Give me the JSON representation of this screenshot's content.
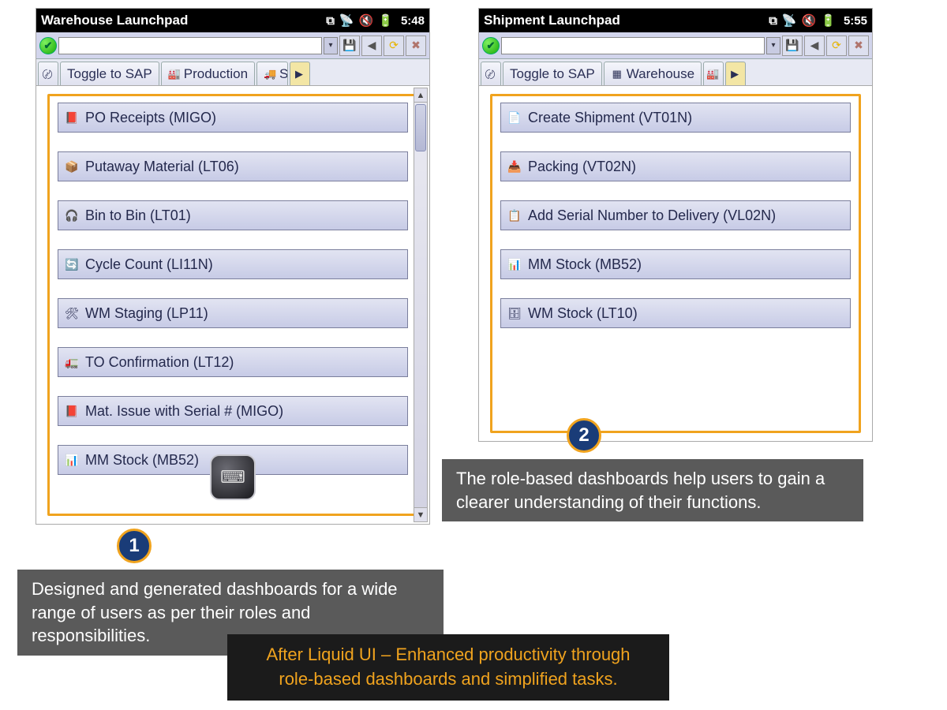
{
  "leftDevice": {
    "statusbar": {
      "title": "Warehouse Launchpad",
      "time": "5:48"
    },
    "tabs": {
      "t0_icon": "〄",
      "t1_label": "Toggle to SAP",
      "t2_icon": "🏭",
      "t2_label": "Production",
      "t3_icon": "🚚",
      "t3_label": "S"
    },
    "rows": [
      {
        "icon": "📕",
        "label": "PO Receipts (MIGO)"
      },
      {
        "icon": "📦",
        "label": "Putaway Material (LT06)"
      },
      {
        "icon": "🎧",
        "label": "Bin to Bin (LT01)"
      },
      {
        "icon": "🔄",
        "label": "Cycle Count (LI11N)"
      },
      {
        "icon": "🛠",
        "label": "WM Staging (LP11)"
      },
      {
        "icon": "🚛",
        "label": "TO Confirmation (LT12)"
      },
      {
        "icon": "📕",
        "label": "Mat. Issue with Serial # (MIGO)"
      },
      {
        "icon": "📊",
        "label": "MM Stock (MB52)"
      }
    ]
  },
  "rightDevice": {
    "statusbar": {
      "title": "Shipment Launchpad",
      "time": "5:55"
    },
    "tabs": {
      "t0_icon": "〄",
      "t1_label": "Toggle to SAP",
      "t2_icon": "▦",
      "t2_label": "Warehouse",
      "t3_icon": "🏭"
    },
    "rows": [
      {
        "icon": "📄",
        "label": "Create Shipment (VT01N)"
      },
      {
        "icon": "📥",
        "label": "Packing (VT02N)"
      },
      {
        "icon": "📋",
        "label": "Add Serial Number to Delivery (VL02N)"
      },
      {
        "icon": "📊",
        "label": "MM Stock (MB52)"
      },
      {
        "icon": "🗄",
        "label": "WM Stock (LT10)"
      }
    ]
  },
  "captions": {
    "badge1": "1",
    "badge2": "2",
    "caption1": "Designed and generated dashboards for a wide range of users as per their roles and responsibilities.",
    "caption2": "The role-based dashboards help users to gain a clearer understanding of their functions.",
    "footer_line1": "After Liquid UI – Enhanced productivity through",
    "footer_line2": "role-based dashboards and simplified tasks."
  }
}
